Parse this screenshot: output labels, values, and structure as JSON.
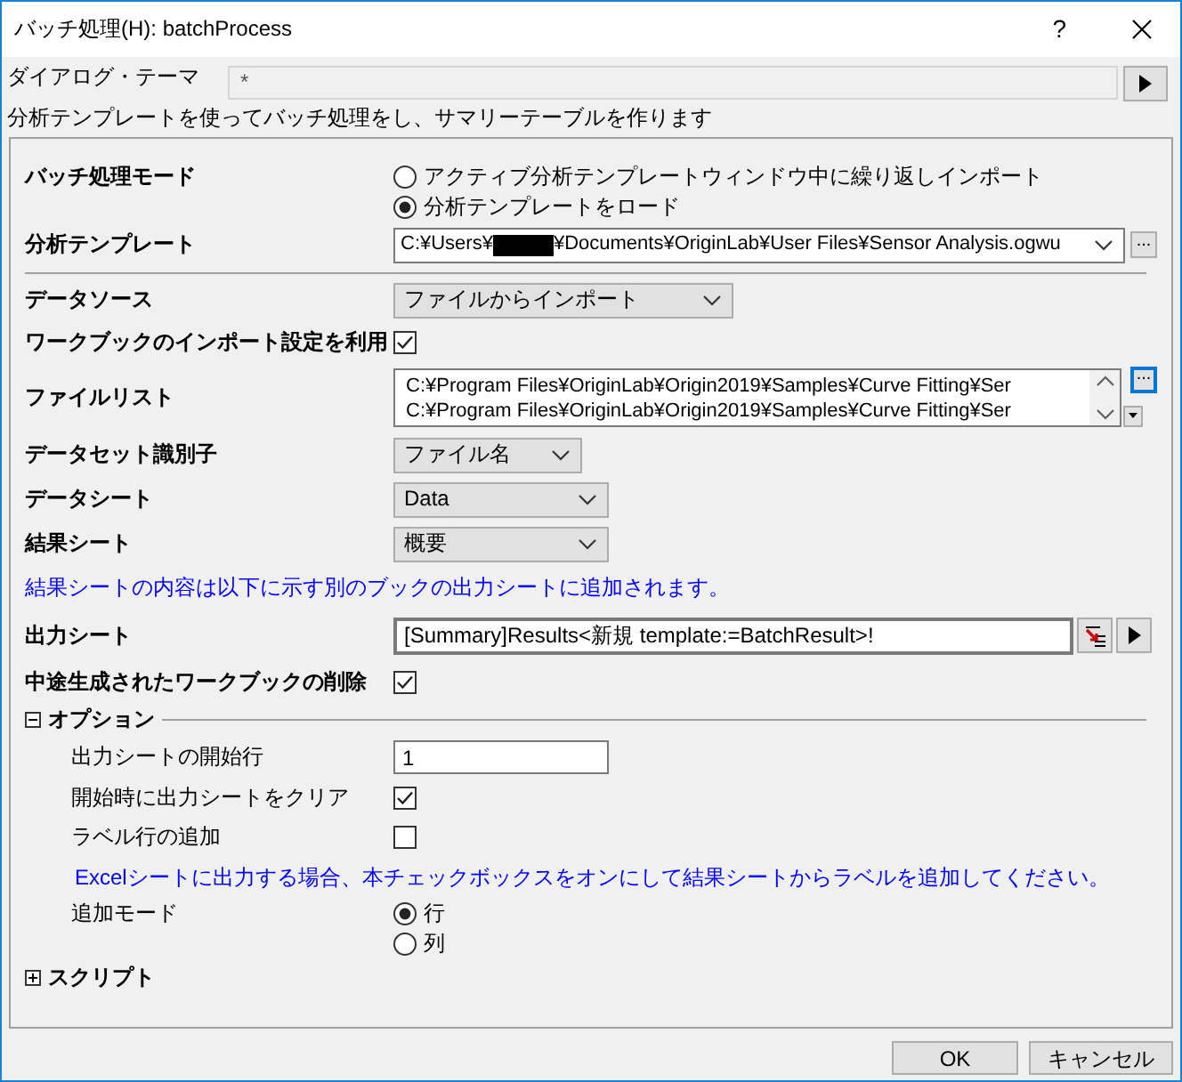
{
  "window": {
    "title": "バッチ処理(H): batchProcess",
    "help": "?"
  },
  "theme": {
    "label": "ダイアログ・テーマ",
    "value": "*"
  },
  "description": "分析テンプレートを使ってバッチ処理をし、サマリーテーブルを作ります",
  "rows": [
    {
      "kind": "radio",
      "label": "バッチ処理モード",
      "options": [
        {
          "label": "アクティブ分析テンプレートウィンドウ中に繰り返しインポート",
          "selected": false
        },
        {
          "label": "分析テンプレートをロード",
          "selected": true
        }
      ]
    },
    {
      "kind": "combo",
      "label": "分析テンプレート",
      "editable": true,
      "value_start": "C:¥Users¥",
      "redacted": true,
      "value_end": "¥Documents¥OriginLab¥User Files¥Sensor Analysis.ogwu",
      "button": "..."
    },
    {
      "kind": "separator"
    },
    {
      "kind": "combo",
      "label": "データソース",
      "editable": false,
      "value": "ファイルからインポート"
    },
    {
      "kind": "check",
      "label": "ワークブックのインポート設定を利用",
      "checked": true
    },
    {
      "kind": "list",
      "label": "ファイルリスト",
      "items": [
        "C:¥Program Files¥OriginLab¥Origin2019¥Samples¥Curve Fitting¥Ser",
        "C:¥Program Files¥OriginLab¥Origin2019¥Samples¥Curve Fitting¥Ser"
      ],
      "button": "..."
    },
    {
      "kind": "combo",
      "label": "データセット識別子",
      "editable": false,
      "value": "ファイル名"
    },
    {
      "kind": "combo",
      "label": "データシート",
      "editable": false,
      "value": "Data"
    },
    {
      "kind": "combo",
      "label": "結果シート",
      "editable": false,
      "value": "概要"
    },
    {
      "kind": "note",
      "text": "結果シートの内容は以下に示す別のブックの出力シートに追加されます。"
    },
    {
      "kind": "output",
      "label": "出力シート",
      "value": "[Summary]Results<新規 template:=BatchResult>!"
    },
    {
      "kind": "check",
      "label": "中途生成されたワークブックの削除",
      "checked": true
    },
    {
      "kind": "section",
      "label": "オプション",
      "expanded": true,
      "children": [
        {
          "kind": "field",
          "label": "出力シートの開始行",
          "value": "1"
        },
        {
          "kind": "check",
          "label": "開始時に出力シートをクリア",
          "checked": true
        },
        {
          "kind": "check",
          "label": "ラベル行の追加",
          "checked": false
        },
        {
          "kind": "note",
          "text": "Excelシートに出力する場合、本チェックボックスをオンにして結果シートからラベルを追加してください。"
        },
        {
          "kind": "radio",
          "label": "追加モード",
          "options": [
            {
              "label": "行",
              "selected": true
            },
            {
              "label": "列",
              "selected": false
            }
          ]
        }
      ]
    },
    {
      "kind": "section",
      "label": "スクリプト",
      "expanded": false
    }
  ],
  "buttons": [
    "OK",
    "キャンセル"
  ]
}
